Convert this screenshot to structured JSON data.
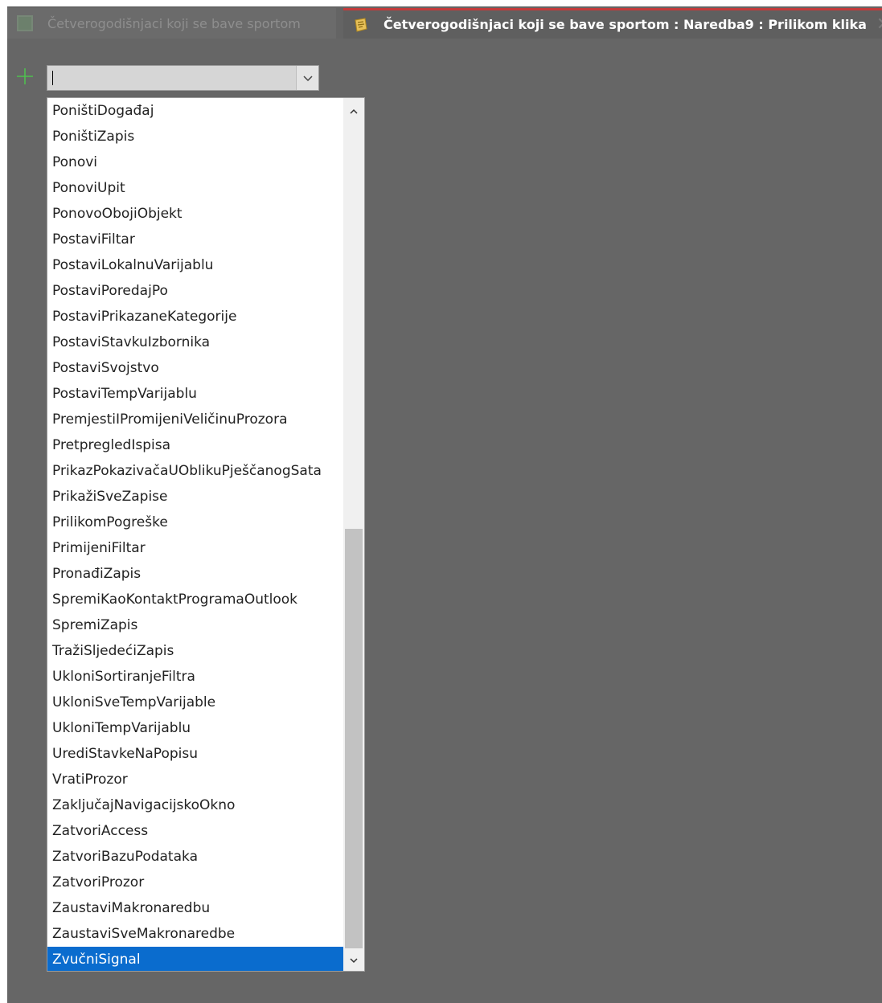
{
  "tabs": [
    {
      "label": "Četverogodišnjaci koji se bave sportom",
      "active": false,
      "icon": "form-icon"
    },
    {
      "label": "Četverogodišnjaci koji se bave sportom : Naredba9 : Prilikom klika",
      "active": true,
      "icon": "macro-icon"
    }
  ],
  "combo": {
    "value": "",
    "button_icon": "chevron-down-icon"
  },
  "add_icon": "plus-icon",
  "dropdown": {
    "items": [
      "PoništiDogađaj",
      "PoništiZapis",
      "Ponovi",
      "PonoviUpit",
      "PonovoObojiObjekt",
      "PostaviFiltar",
      "PostaviLokalnuVarijablu",
      "PostaviPoredajPo",
      "PostaviPrikazaneKategorije",
      "PostaviStavkuIzbornika",
      "PostaviSvojstvo",
      "PostaviTempVarijablu",
      "PremjestiIPromijeniVeličinuProzora",
      "PretpregledIspisa",
      "PrikazPokazivačaUOblikuPješčanogSata",
      "PrikažiSveZapise",
      "PrilikomPogreške",
      "PrimijeniFiltar",
      "PronađiZapis",
      "SpremiKaoKontaktProgramaOutlook",
      "SpremiZapis",
      "TražiSljedećiZapis",
      "UkloniSortiranjeFiltra",
      "UkloniSveTempVarijable",
      "UkloniTempVarijablu",
      "UrediStavkeNaPopisu",
      "VratiProzor",
      "ZaključajNavigacijskoOkno",
      "ZatvoriAccess",
      "ZatvoriBazuPodataka",
      "ZatvoriProzor",
      "ZaustaviMakronaredbu",
      "ZaustaviSveMakronaredbe",
      "ZvučniSignal"
    ],
    "selected_index": 33,
    "scroll_position": 0.95
  },
  "colors": {
    "workspace": "#666666",
    "tab_accent": "#c43b3b",
    "selection": "#0a6cce",
    "add_icon": "#4fbf4f"
  }
}
